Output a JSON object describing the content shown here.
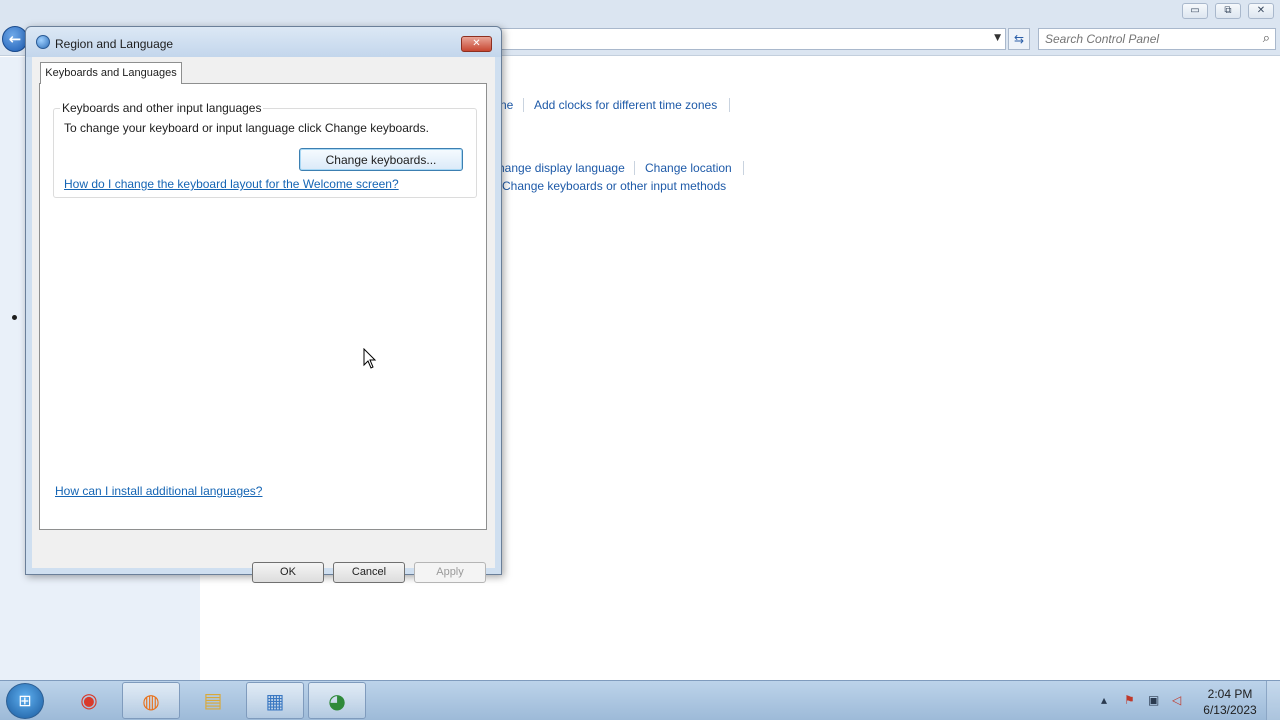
{
  "control_panel": {
    "window_controls": {
      "minimize": "▭",
      "maximize": "⧉",
      "close": "✕"
    },
    "search": {
      "placeholder": "Search Control Panel"
    },
    "links": {
      "partial_time": "ne",
      "add_clocks": "Add clocks for different time zones",
      "change_display_language": "hange display language",
      "change_location": "Change location",
      "change_keyboards": "Change keyboards or other input methods"
    }
  },
  "dialog": {
    "title": "Region and Language",
    "close_glyph": "✕",
    "tab_label": "Keyboards and Languages",
    "group": {
      "title": "Keyboards and other input languages",
      "description": "To change your keyboard or input language click Change keyboards.",
      "button_label": "Change keyboards...",
      "welcome_link": "How do I change the keyboard layout for the Welcome screen?"
    },
    "install_link": "How can I install additional languages?",
    "buttons": {
      "ok": "OK",
      "cancel": "Cancel",
      "apply": "Apply"
    }
  },
  "taskbar": {
    "items": [
      {
        "name": "chrome-icon",
        "glyph": "◉",
        "color": "#d93b2b"
      },
      {
        "name": "firefox-icon",
        "glyph": "◍",
        "color": "#e8701a"
      },
      {
        "name": "file-explorer-icon",
        "glyph": "▤",
        "color": "#d9a93a"
      },
      {
        "name": "control-panel-icon",
        "glyph": "▦",
        "color": "#3a78c2"
      },
      {
        "name": "region-language-icon",
        "glyph": "◕",
        "color": "#2f8a3a"
      }
    ],
    "clock": {
      "time": "2:04 PM",
      "date": "6/13/2023"
    }
  }
}
